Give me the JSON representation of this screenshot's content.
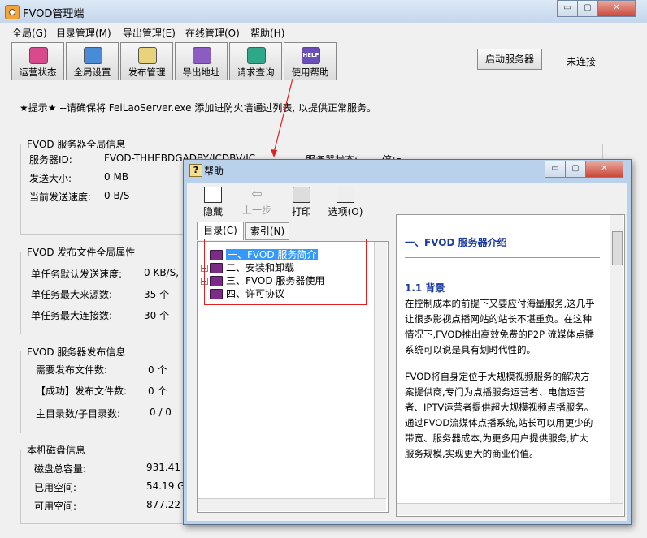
{
  "window": {
    "title": "FVOD管理端",
    "min_label": "▭",
    "max_label": "▢",
    "close_label": "✕"
  },
  "menu": [
    "全局(G)",
    "目录管理(M)",
    "导出管理(E)",
    "在线管理(O)",
    "帮助(H)"
  ],
  "toolbar": [
    {
      "label": "运营状态",
      "icon": "monitor-icon",
      "color": "#d84a8c"
    },
    {
      "label": "全局设置",
      "icon": "settings-icon",
      "color": "#4a8bd8"
    },
    {
      "label": "发布管理",
      "icon": "publish-icon",
      "color": "#e8d27a"
    },
    {
      "label": "导出地址",
      "icon": "export-icon",
      "color": "#8a5cc4"
    },
    {
      "label": "请求查询",
      "icon": "query-icon",
      "color": "#2fa88a"
    },
    {
      "label": "使用帮助",
      "icon": "help-icon",
      "color": "#6a4fb8",
      "badge": "HELP"
    }
  ],
  "start_button": "启动服务器",
  "connection_status": "未连接",
  "tip": "★提示★ --请确保将 FeiLaoServer.exe  添加进防火墙通过列表, 以提供正常服务。",
  "server_info": {
    "title": "FVOD 服务器全局信息",
    "id_label": "服务器ID:",
    "id_value": "FVOD-THHEBDGADBY/ICDBV/IC",
    "status_label": "服务器状态:",
    "status_value": "停止",
    "send_size_label": "发送大小:",
    "send_size_value": "0 MB",
    "speed_label": "当前发送速度:",
    "speed_value": "0 B/S"
  },
  "publish_props": {
    "title": "FVOD 发布文件全局属性",
    "rows": [
      {
        "label": "单任务默认发送速度:",
        "value": "0 KB/S,"
      },
      {
        "label": "单任务最大来源数:",
        "value": "35 个"
      },
      {
        "label": "单任务最大连接数:",
        "value": "30 个"
      }
    ]
  },
  "publish_info": {
    "title": "FVOD 服务器发布信息",
    "rows": [
      {
        "label": "需要发布文件数:",
        "value": "0 个"
      },
      {
        "label": "【成功】发布文件数:",
        "value": "0 个"
      },
      {
        "label": "主目录数/子目录数:",
        "value": "0 / 0"
      }
    ]
  },
  "disk_info": {
    "title": "本机磁盘信息",
    "rows": [
      {
        "label": "磁盘总容量:",
        "value": "931.41"
      },
      {
        "label": "已用空间:",
        "value": "54.19 G"
      },
      {
        "label": "可用空间:",
        "value": "877.22"
      }
    ]
  },
  "help": {
    "title": "帮助",
    "toolbar": [
      {
        "label": "隐藏",
        "icon": "hide-icon",
        "enabled": true
      },
      {
        "label": "上一步",
        "icon": "back-icon",
        "enabled": false
      },
      {
        "label": "打印",
        "icon": "print-icon",
        "enabled": true
      },
      {
        "label": "选项(O)",
        "icon": "options-icon",
        "enabled": true
      }
    ],
    "tabs": [
      "目录(C)",
      "索引(N)"
    ],
    "tree": [
      "一、FVOD 服务简介",
      "二、安装和卸载",
      "三、FVOD 服务器使用",
      "四、许可协议"
    ],
    "heading": "一、FVOD 服务器介绍",
    "sub_heading": "1.1  背景",
    "para1": "在控制成本的前提下又要应付海量服务,这几乎让很多影视点播网站的站长不堪重负。在这种情况下,FVOD推出高效免费的P2P 流媒体点播系统可以说是具有划时代性的。",
    "para2": "FVOD将自身定位于大规模视频服务的解决方案提供商,专门为点播服务运营者、电信运营者、IPTV运营者提供超大规模视频点播服务。通过FVOD流媒体点播系统,站长可以用更少的带宽、服务器成本,为更多用户提供服务,扩大服务规模,实现更大的商业价值。"
  }
}
